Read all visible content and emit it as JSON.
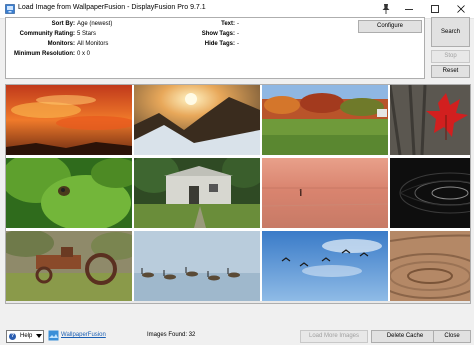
{
  "window": {
    "title": "Load Image from WallpaperFusion - DisplayFusion Pro 9.7.1"
  },
  "filters": {
    "sort_by": {
      "label": "Sort By:",
      "value": "Age (newest)"
    },
    "community_rating": {
      "label": "Community Rating:",
      "value": "5 Stars"
    },
    "monitors": {
      "label": "Monitors:",
      "value": "All Monitors"
    },
    "min_resolution": {
      "label": "Minimum Resolution:",
      "value": "0 x 0"
    },
    "text": {
      "label": "Text:",
      "value": "-"
    },
    "show_tags": {
      "label": "Show Tags:",
      "value": "-"
    },
    "hide_tags": {
      "label": "Hide Tags:",
      "value": "-"
    },
    "configure_label": "Configure"
  },
  "side_buttons": {
    "search": "Search",
    "stop": "Stop",
    "reset": "Reset"
  },
  "gallery": {
    "thumbnails": [
      "sunset-clouds",
      "sunset-mountain",
      "autumn-field",
      "red-maple-leaf",
      "green-leaf-insect",
      "stone-ruins",
      "lake-sunset",
      "dark-fractal",
      "rusty-tractor",
      "geese-on-lake",
      "flying-birds",
      "wood-texture"
    ]
  },
  "statusbar": {
    "help_label": "Help",
    "wallpaperfusion_link": "WallpaperFusion",
    "images_found": "Images Found: 32",
    "load_more": "Load More Images",
    "delete_cache": "Delete Cache",
    "close": "Close"
  },
  "colors": {
    "link": "#1a5fb4",
    "disabled_text": "#a0a0a0",
    "button_bg": "#e1e1e1"
  }
}
